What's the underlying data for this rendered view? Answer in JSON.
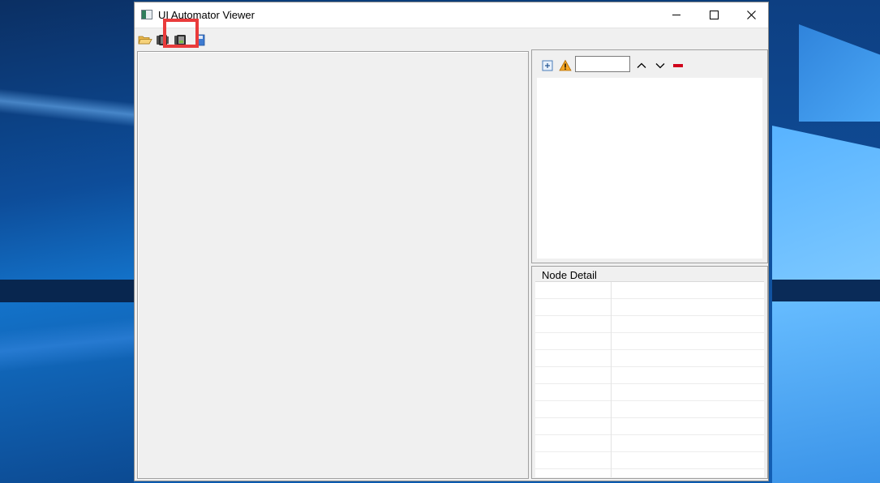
{
  "window": {
    "title": "UI Automator Viewer",
    "buttons": {
      "minimize_icon": "minimize-icon",
      "maximize_icon": "maximize-icon",
      "close_icon": "close-icon"
    }
  },
  "toolbar": {
    "items": [
      {
        "name": "open-icon"
      },
      {
        "name": "device-screenshot-icon"
      },
      {
        "name": "device-screenshot-compressed-icon",
        "highlighted": true
      },
      {
        "name": "save-icon"
      }
    ],
    "highlight_color": "#e93b3b"
  },
  "hierarchy": {
    "search_value": "",
    "buttons": [
      "expand-all-icon",
      "warning-icon",
      "search-input",
      "previous-icon",
      "next-icon",
      "clear-icon"
    ]
  },
  "node_detail": {
    "title": "Node Detail",
    "rows": 11
  }
}
